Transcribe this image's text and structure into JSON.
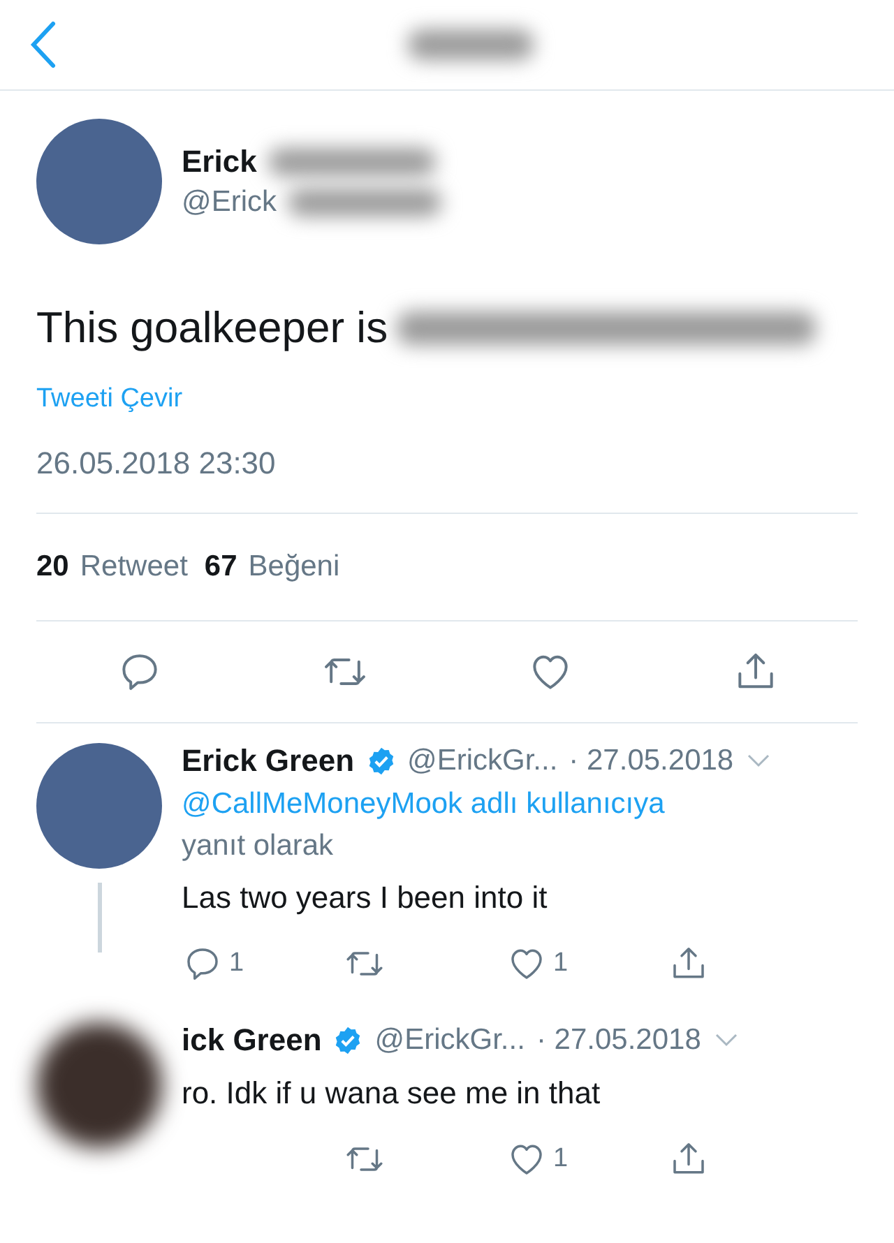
{
  "tweet": {
    "name": "Erick",
    "handle": "@Erick",
    "text": "This goalkeeper is",
    "translate": "Tweeti Çevir",
    "timestamp": "26.05.2018 23:30",
    "stats": [
      {
        "count": "20",
        "label": "Retweet"
      },
      {
        "count": "67",
        "label": "Beğeni"
      }
    ],
    "actions": [
      {
        "kind": "reply"
      },
      {
        "kind": "retweet"
      },
      {
        "kind": "like"
      },
      {
        "kind": "share"
      }
    ]
  },
  "replies": [
    {
      "name": "Erick Green",
      "verified": true,
      "handle": "@ErickGr...",
      "date": "· 27.05.2018",
      "avatar_blurred": false,
      "reply_to": "@CallMeMoneyMook adlı kullanıcıya",
      "reply_to_suffix": "yanıt olarak",
      "text": "Las two years I been into it",
      "thread_line": true,
      "actions": [
        {
          "kind": "reply",
          "count": "1"
        },
        {
          "kind": "retweet"
        },
        {
          "kind": "like",
          "count": "1"
        },
        {
          "kind": "share"
        }
      ]
    },
    {
      "name": "ick Green",
      "verified": true,
      "handle": "@ErickGr...",
      "date": "· 27.05.2018",
      "avatar_blurred": true,
      "text": "ro. Idk if u wana see me in that",
      "thread_line": false,
      "actions": [
        {
          "kind": "retweet"
        },
        {
          "kind": "like",
          "count": "1"
        },
        {
          "kind": "share"
        }
      ]
    }
  ]
}
